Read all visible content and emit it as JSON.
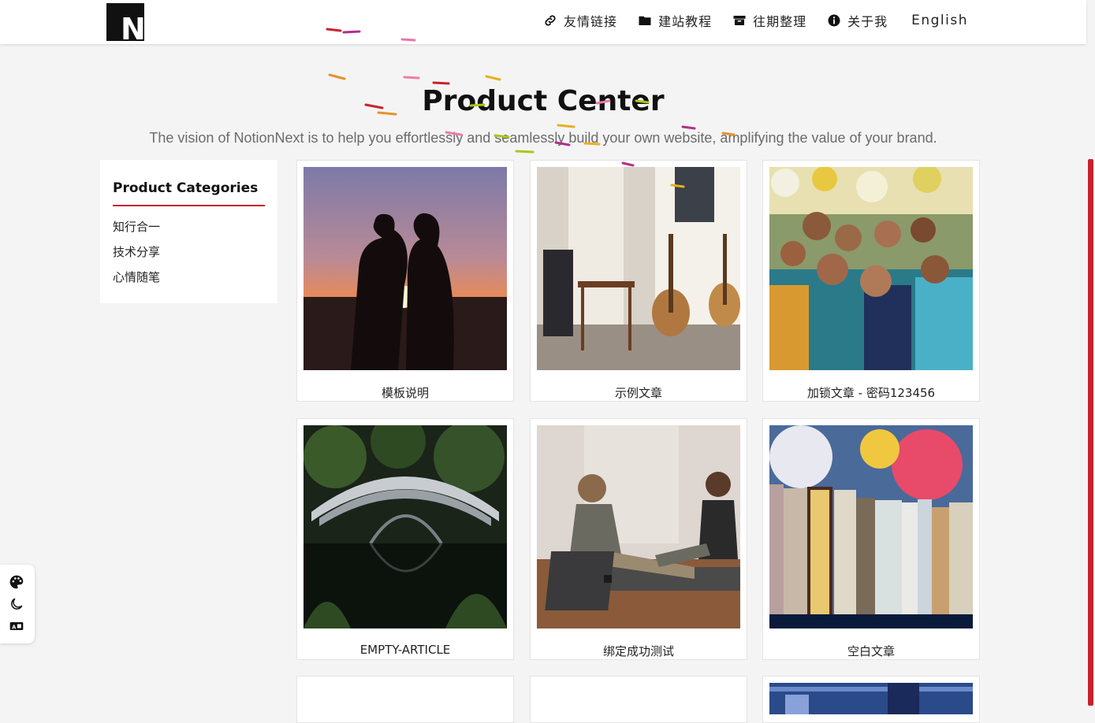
{
  "header": {
    "logo_letter": "N",
    "nav": [
      {
        "label": "友情链接",
        "icon": "link-icon"
      },
      {
        "label": "建站教程",
        "icon": "folder-icon"
      },
      {
        "label": "往期整理",
        "icon": "archive-icon"
      },
      {
        "label": "关于我",
        "icon": "info-icon"
      }
    ],
    "language": "English"
  },
  "hero": {
    "title": "Product Center",
    "subtitle": "The vision of NotionNext is to help you effortlessly and seamlessly build your own website, amplifying the value of your brand."
  },
  "sidebar": {
    "title": "Product Categories",
    "categories": [
      "知行合一",
      "技术分享",
      "心情随笔"
    ]
  },
  "products": [
    {
      "title": "模板说明"
    },
    {
      "title": "示例文章"
    },
    {
      "title": "加锁文章 - 密码123456"
    },
    {
      "title": "EMPTY-ARTICLE"
    },
    {
      "title": "绑定成功测试"
    },
    {
      "title": "空白文章"
    }
  ],
  "tools": [
    "palette-icon",
    "moon-icon",
    "translate-icon"
  ],
  "colors": {
    "accent": "#c9222e",
    "background": "#f4f4f4",
    "card": "#ffffff",
    "subtitle": "#6b6b6b"
  }
}
